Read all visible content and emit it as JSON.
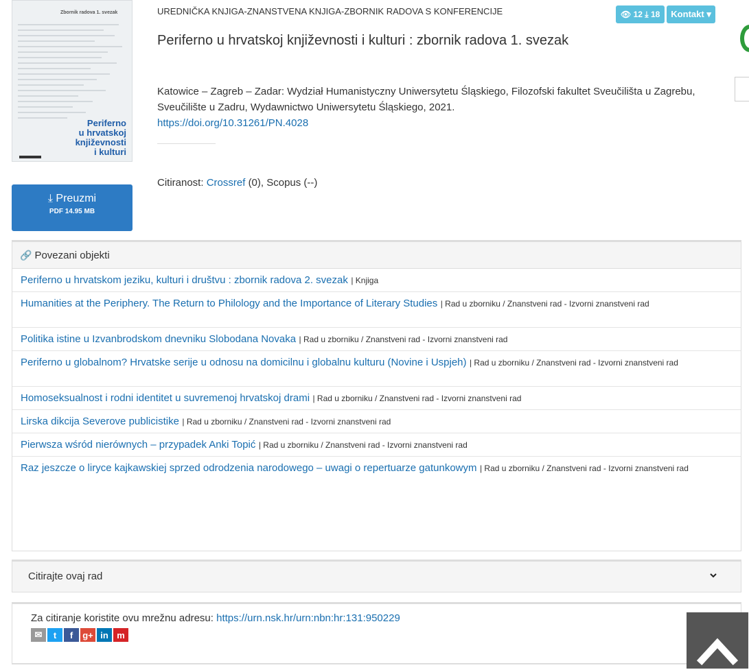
{
  "cover": {
    "header": "Zbornik radova 1. svezak",
    "title_lines": [
      "Periferno",
      "u hrvatskoj",
      "književnosti",
      "i kulturi"
    ]
  },
  "download": {
    "label": "Preuzmi",
    "file": "PDF 14.95 MB"
  },
  "category": "UREDNIČKA KNJIGA-ZNANSTVENA KNJIGA-ZBORNIK RADOVA S KONFERENCIJE",
  "stats": {
    "views": "12",
    "downloads": "18"
  },
  "contact_label": "Kontakt",
  "title": "Periferno u hrvatskoj književnosti i kulturi : zbornik radova 1. svezak",
  "publisher": "Katowice – Zagreb – Zadar: Wydział Humanistyczny Uniwersytetu Śląskiego, Filozofski fakultet Sveučilišta u Zagrebu, Sveučilište u Zadru, Wydawnictwo Uniwersytetu Śląskiego, 2021.",
  "doi": "https://doi.org/10.31261/PN.4028",
  "citations": {
    "label": "Citiranost:",
    "crossref_label": "Crossref",
    "crossref_value": "(0),",
    "scopus": "Scopus (--)"
  },
  "related": {
    "header": "Povezani objekti",
    "items": [
      {
        "title": "Periferno u hrvatskom jeziku, kulturi i društvu : zbornik radova 2. svezak",
        "meta": "| Knjiga"
      },
      {
        "title": "Humanities at the Periphery. The Return to Philology and the Importance of Literary Studies",
        "meta": "| Rad u zborniku / Znanstveni rad - Izvorni znanstveni rad"
      },
      {
        "title": "Politika istine u Izvanbrodskom dnevniku Slobodana Novaka",
        "meta": "| Rad u zborniku / Znanstveni rad - Izvorni znanstveni rad"
      },
      {
        "title": "Periferno u globalnom? Hrvatske serije u odnosu na domicilnu i globalnu kulturu (Novine i Uspjeh)",
        "meta": "| Rad u zborniku / Znanstveni rad - Izvorni znanstveni rad"
      },
      {
        "title": "Homoseksualnost i rodni identitet u suvremenoj hrvatskoj drami",
        "meta": "| Rad u zborniku / Znanstveni rad - Izvorni znanstveni rad"
      },
      {
        "title": "Lirska dikcija Severove publicistike",
        "meta": "| Rad u zborniku / Znanstveni rad - Izvorni znanstveni rad"
      },
      {
        "title": "Pierwsza wśród nierównych – przypadek Anki Topić",
        "meta": "| Rad u zborniku / Znanstveni rad - Izvorni znanstveni rad"
      },
      {
        "title": "Raz jeszcze o liryce kajkawskiej sprzed odrodzenia narodowego – uwagi o repertuarze gatunkowym",
        "meta": "| Rad u zborniku / Znanstveni rad - Izvorni znanstveni rad"
      }
    ]
  },
  "cite": {
    "label": "Citirajte ovaj rad",
    "url_text": "Za citiranje koristite ovu mrežnu adresu:",
    "url": "https://urn.nsk.hr/urn:nbn:hr:131:950229"
  },
  "share": [
    {
      "icon": "email-icon",
      "glyph": "✉",
      "color": "#999999"
    },
    {
      "icon": "twitter-icon",
      "glyph": "t",
      "color": "#1da1f2"
    },
    {
      "icon": "facebook-icon",
      "glyph": "f",
      "color": "#3b5998"
    },
    {
      "icon": "google-plus-icon",
      "glyph": "g+",
      "color": "#dd4b39"
    },
    {
      "icon": "linkedin-icon",
      "glyph": "in",
      "color": "#0077b5"
    },
    {
      "icon": "mendeley-icon",
      "glyph": "m",
      "color": "#d52427"
    }
  ],
  "colors": {
    "accent": "#2d7bc4",
    "badge": "#5bc0de",
    "link": "#1a6fb0"
  }
}
